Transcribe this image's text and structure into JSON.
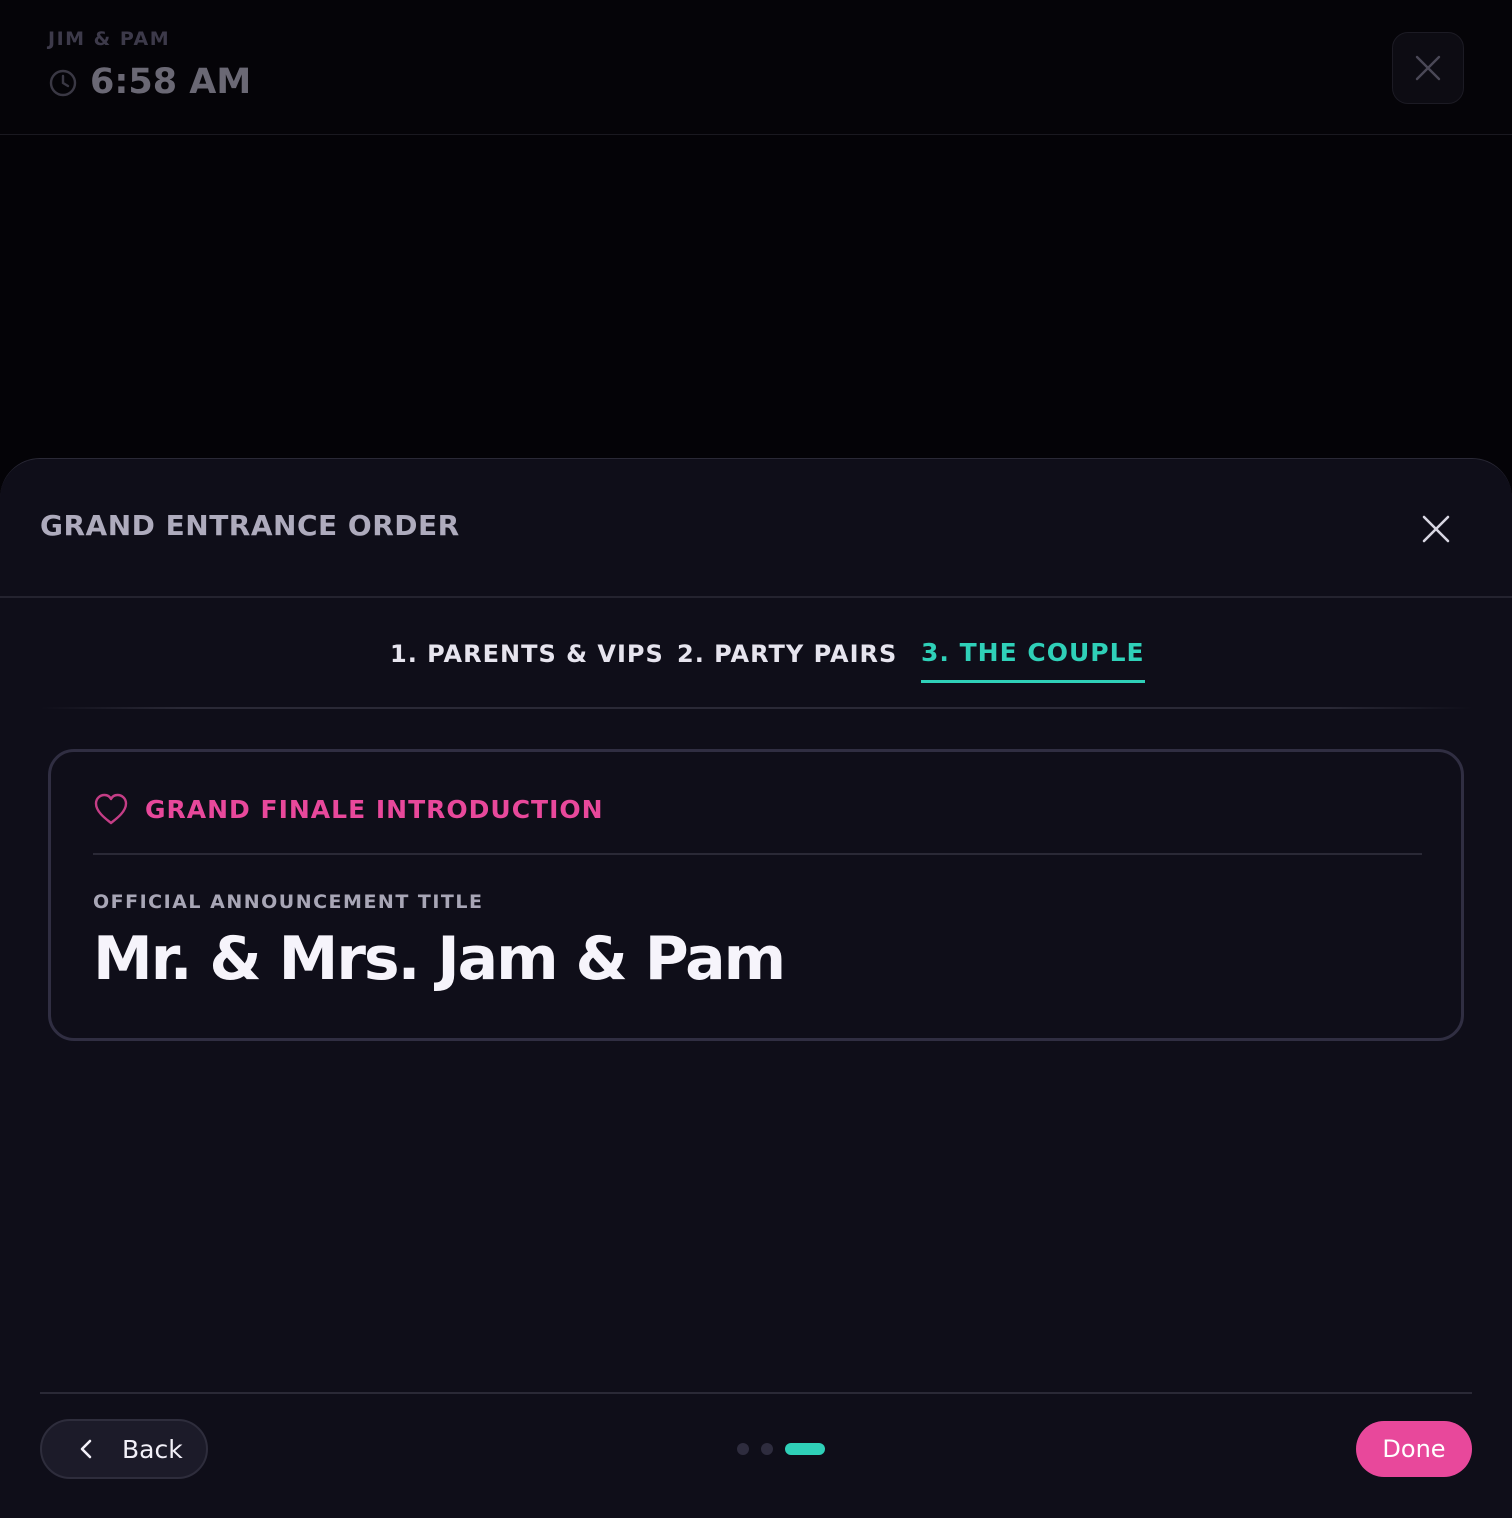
{
  "background": {
    "couple_name": "JIM & PAM",
    "time": "6:58 AM",
    "close_icon": "close-icon"
  },
  "sheet": {
    "title": "GRAND ENTRANCE ORDER",
    "close_icon": "close-icon",
    "tabs": [
      {
        "label": "1. PARENTS & VIPS",
        "active": false
      },
      {
        "label": "2. PARTY PAIRS",
        "active": false
      },
      {
        "label": "3. THE COUPLE",
        "active": true
      }
    ],
    "card": {
      "icon": "heart-icon",
      "heading": "GRAND FINALE INTRODUCTION",
      "field_label": "OFFICIAL ANNOUNCEMENT TITLE",
      "field_value": "Mr. & Mrs. Jam & Pam"
    },
    "footer": {
      "back_label": "Back",
      "done_label": "Done",
      "step_current": 3,
      "step_total": 3
    }
  },
  "colors": {
    "accent_teal": "#2fd0b8",
    "accent_pink": "#e8489b",
    "sheet_bg": "#0f0e19",
    "page_bg": "#040307"
  }
}
